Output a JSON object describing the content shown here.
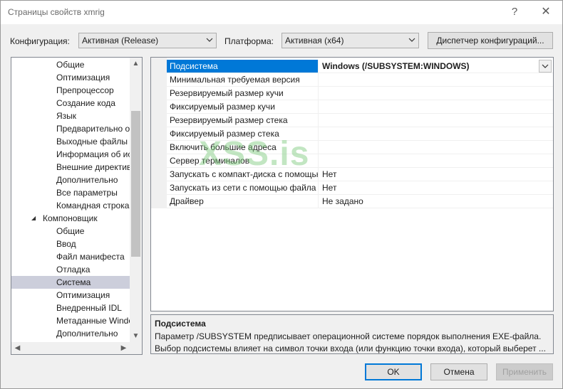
{
  "window": {
    "title": "Страницы свойств xmrig",
    "help_glyph": "?",
    "close_glyph": "✕"
  },
  "toolbar": {
    "config_label": "Конфигурация:",
    "config_value": "Активная (Release)",
    "platform_label": "Платформа:",
    "platform_value": "Активная (x64)",
    "config_manager_label": "Диспетчер конфигураций..."
  },
  "tree": {
    "items": [
      {
        "label": "Общие",
        "indent": 2,
        "selected": false
      },
      {
        "label": "Оптимизация",
        "indent": 2,
        "selected": false
      },
      {
        "label": "Препроцессор",
        "indent": 2,
        "selected": false
      },
      {
        "label": "Создание кода",
        "indent": 2,
        "selected": false
      },
      {
        "label": "Язык",
        "indent": 2,
        "selected": false
      },
      {
        "label": "Предварительно откомпилированные заголовки",
        "indent": 2,
        "selected": false
      },
      {
        "label": "Выходные файлы",
        "indent": 2,
        "selected": false
      },
      {
        "label": "Информация об исходном файле",
        "indent": 2,
        "selected": false
      },
      {
        "label": "Внешние директивы включения",
        "indent": 2,
        "selected": false
      },
      {
        "label": "Дополнительно",
        "indent": 2,
        "selected": false
      },
      {
        "label": "Все параметры",
        "indent": 2,
        "selected": false
      },
      {
        "label": "Командная строка",
        "indent": 2,
        "selected": false
      },
      {
        "label": "Компоновщик",
        "indent": 1,
        "selected": false,
        "expanded": true
      },
      {
        "label": "Общие",
        "indent": 2,
        "selected": false
      },
      {
        "label": "Ввод",
        "indent": 2,
        "selected": false
      },
      {
        "label": "Файл манифеста",
        "indent": 2,
        "selected": false
      },
      {
        "label": "Отладка",
        "indent": 2,
        "selected": false
      },
      {
        "label": "Система",
        "indent": 2,
        "selected": true
      },
      {
        "label": "Оптимизация",
        "indent": 2,
        "selected": false
      },
      {
        "label": "Внедренный IDL",
        "indent": 2,
        "selected": false
      },
      {
        "label": "Метаданные Windows",
        "indent": 2,
        "selected": false
      },
      {
        "label": "Дополнительно",
        "indent": 2,
        "selected": false
      }
    ],
    "expand_glyph": "◢"
  },
  "properties": {
    "rows": [
      {
        "name": "Подсистема",
        "value": "Windows (/SUBSYSTEM:WINDOWS)",
        "selected": true
      },
      {
        "name": "Минимальная требуемая версия",
        "value": "",
        "selected": false
      },
      {
        "name": "Резервируемый размер кучи",
        "value": "",
        "selected": false
      },
      {
        "name": "Фиксируемый размер кучи",
        "value": "",
        "selected": false
      },
      {
        "name": "Резервируемый размер стека",
        "value": "",
        "selected": false
      },
      {
        "name": "Фиксируемый размер стека",
        "value": "",
        "selected": false
      },
      {
        "name": "Включить большие адреса",
        "value": "",
        "selected": false
      },
      {
        "name": "Сервер терминалов",
        "value": "",
        "selected": false
      },
      {
        "name": "Запускать с компакт-диска с помощью файла подкачки",
        "value": "Нет",
        "selected": false
      },
      {
        "name": "Запускать из сети с помощью файла подкачки",
        "value": "Нет",
        "selected": false
      },
      {
        "name": "Драйвер",
        "value": "Не задано",
        "selected": false
      }
    ]
  },
  "watermark": "XSS.is",
  "description": {
    "title": "Подсистема",
    "line1": "Параметр /SUBSYSTEM предписывает операционной системе порядок выполнения EXE-файла.",
    "line2": "Выбор подсистемы влияет на символ точки входа (или функцию точки входа), который выберет ..."
  },
  "buttons": {
    "ok": "OK",
    "cancel": "Отмена",
    "apply": "Применить"
  },
  "colors": {
    "accent": "#0078d7",
    "tree_selection": "#cccedb"
  }
}
